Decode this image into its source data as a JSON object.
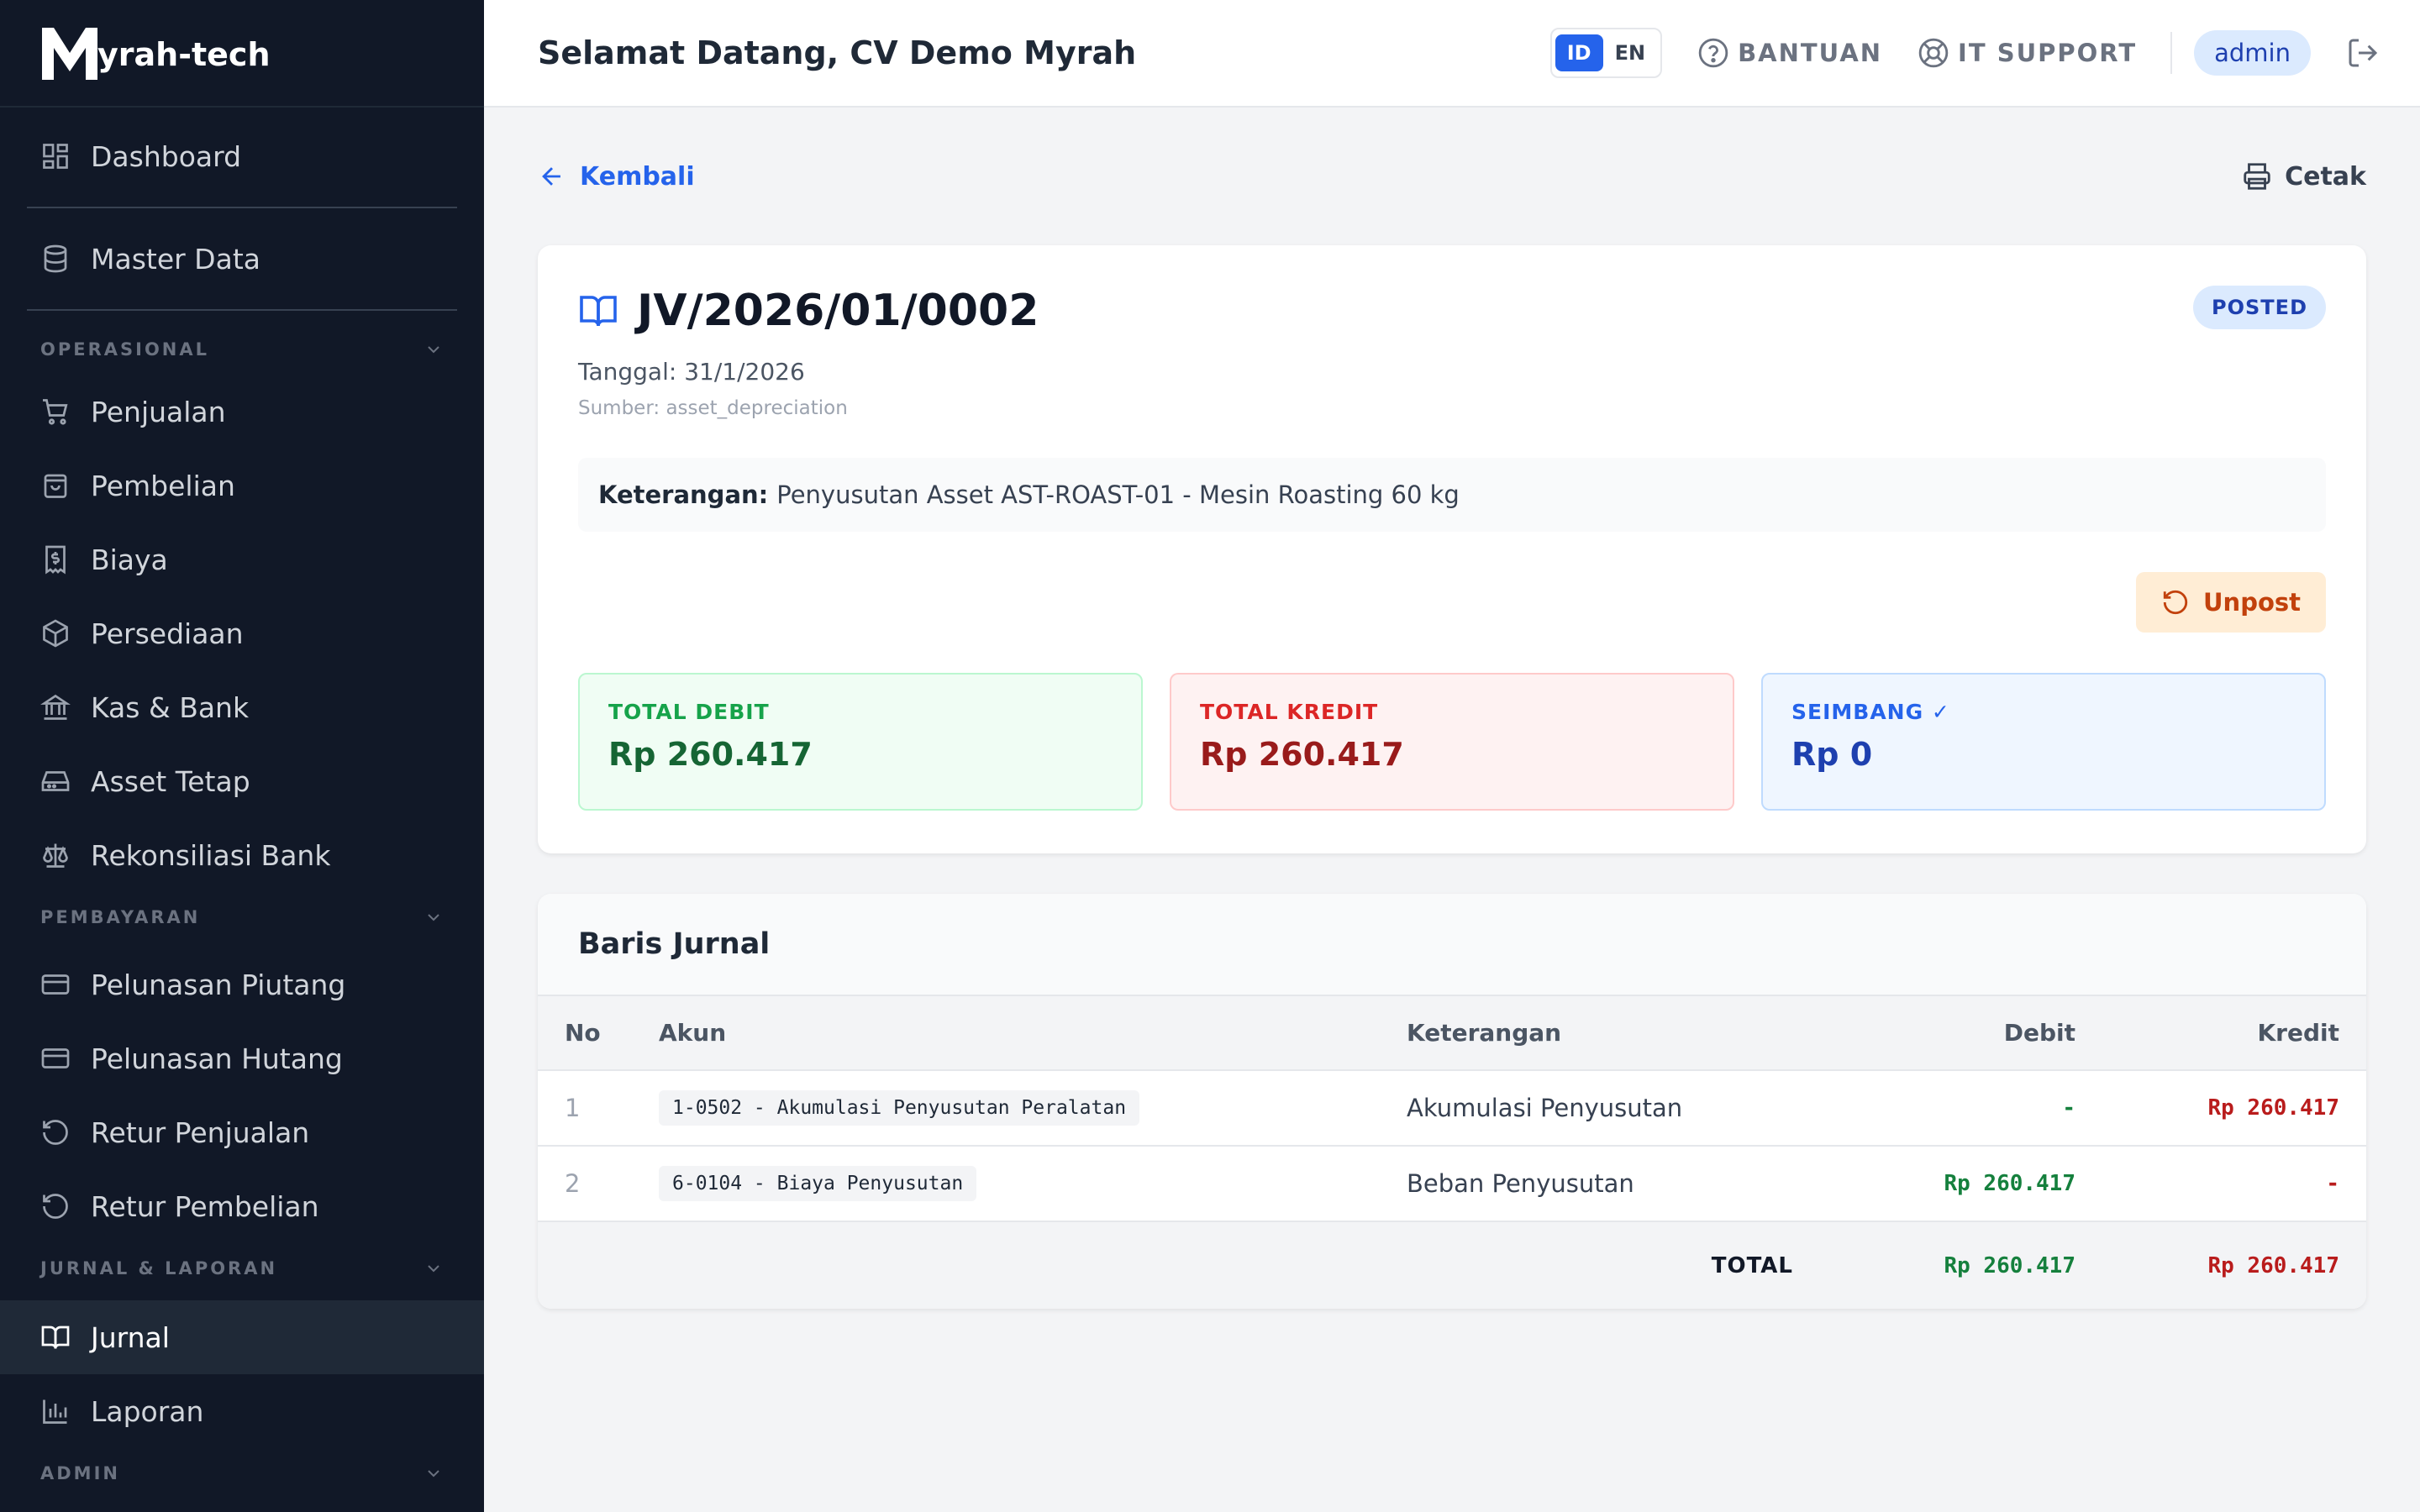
{
  "brand": {
    "name": "yrah-tech",
    "logo_letter": "M"
  },
  "sidebar": {
    "top_items": [
      {
        "label": "Dashboard",
        "icon": "dashboard-icon"
      },
      {
        "label": "Master Data",
        "icon": "database-icon"
      }
    ],
    "sections": {
      "operasional": {
        "title": "OPERASIONAL",
        "items": [
          {
            "label": "Penjualan",
            "icon": "cart-icon"
          },
          {
            "label": "Pembelian",
            "icon": "shopping-bag-icon"
          },
          {
            "label": "Biaya",
            "icon": "receipt-icon"
          },
          {
            "label": "Persediaan",
            "icon": "box-icon"
          },
          {
            "label": "Kas & Bank",
            "icon": "bank-icon"
          },
          {
            "label": "Asset Tetap",
            "icon": "hard-drive-icon"
          },
          {
            "label": "Rekonsiliasi Bank",
            "icon": "scale-icon"
          }
        ]
      },
      "pembayaran": {
        "title": "PEMBAYARAN",
        "items": [
          {
            "label": "Pelunasan Piutang",
            "icon": "credit-card-icon"
          },
          {
            "label": "Pelunasan Hutang",
            "icon": "credit-card-icon"
          },
          {
            "label": "Retur Penjualan",
            "icon": "rotate-icon"
          },
          {
            "label": "Retur Pembelian",
            "icon": "rotate-icon"
          }
        ]
      },
      "jurnal": {
        "title": "JURNAL & LAPORAN",
        "items": [
          {
            "label": "Jurnal",
            "icon": "book-icon",
            "active": true
          },
          {
            "label": "Laporan",
            "icon": "bar-chart-icon"
          }
        ]
      },
      "admin": {
        "title": "ADMIN"
      }
    }
  },
  "topbar": {
    "welcome": "Selamat Datang, CV Demo Myrah",
    "lang_id": "ID",
    "lang_en": "EN",
    "help": "BANTUAN",
    "support": "IT SUPPORT",
    "user": "admin"
  },
  "page": {
    "back": "Kembali",
    "print": "Cetak",
    "journal_number": "JV/2026/01/0002",
    "status": "POSTED",
    "date": "Tanggal: 31/1/2026",
    "source": "Sumber: asset_depreciation",
    "desc_label": "Keterangan:",
    "desc_value": "Penyusutan Asset AST-ROAST-01 - Mesin Roasting 60 kg",
    "unpost": "Unpost",
    "total_debit_label": "TOTAL DEBIT",
    "total_debit": "Rp 260.417",
    "total_kredit_label": "TOTAL KREDIT",
    "total_kredit": "Rp 260.417",
    "balance_label": "SEIMBANG ✓",
    "balance": "Rp 0"
  },
  "lines": {
    "title": "Baris Jurnal",
    "columns": {
      "no": "No",
      "akun": "Akun",
      "ket": "Keterangan",
      "debit": "Debit",
      "kredit": "Kredit"
    },
    "rows": [
      {
        "no": "1",
        "akun": "1-0502 - Akumulasi Penyusutan Peralatan",
        "ket": "Akumulasi Penyusutan",
        "debit": "-",
        "kredit": "Rp 260.417"
      },
      {
        "no": "2",
        "akun": "6-0104 - Biaya Penyusutan",
        "ket": "Beban Penyusutan",
        "debit": "Rp 260.417",
        "kredit": "-"
      }
    ],
    "total_label": "TOTAL",
    "total_debit": "Rp 260.417",
    "total_kredit": "Rp 260.417"
  },
  "colors": {
    "accent": "#2563eb",
    "sidebar_bg": "#111827",
    "success": "#15803d",
    "danger": "#b91c1c",
    "warning": "#c2410c"
  }
}
